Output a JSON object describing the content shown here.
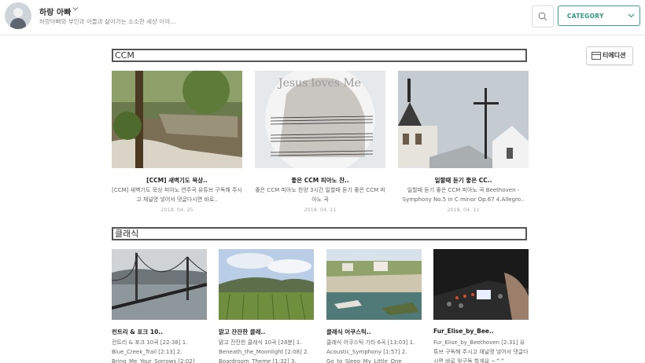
{
  "header": {
    "blog_title": "하랑 아빠",
    "blog_desc": "하랑아빠와 부인과 아들과 살아가는 소소한 세상 이야...",
    "category_label": "CATEGORY",
    "tedition_label": "티에디션"
  },
  "sections": [
    {
      "title": "CCM",
      "posts": [
        {
          "title": "[CCM] 새벽기도 묵상..",
          "summary": "[CCM] 새벽기도 묵상 피아노 연주곡 유튜브 구독해 주시고 채널명 넣어서 댓글다시면 바로..",
          "date": "2018. 04. 25"
        },
        {
          "title": "좋은 CCM 피아노 찬..",
          "summary": "좋은 CCM 피아노 찬양 3시간 일할때 듣기 좋은 CCM 피아노 곡",
          "date": "2018. 04. 11"
        },
        {
          "title": "일할때 듣기 좋은 CC..",
          "summary": "일할때 듣기 좋은 CCM 피아노 곡 Beethoven - Symphony No.5 in C minor Op.67 4.Allegro..",
          "date": "2018. 04. 11"
        }
      ]
    },
    {
      "title": "클래식",
      "posts": [
        {
          "title": "컨트리 & 포크 10..",
          "summary": "컨트리 & 포크 10곡 [22:38] 1. Blue_Creek_Trail [2:13] 2. Bring_Me_Your_Sorrows [2:02]"
        },
        {
          "title": "맑고 잔잔한 클래..",
          "summary": "맑고 잔잔한 클래식 10곡 [28분] 1. Beneath_the_Moonlight [2:08] 2. Boardroom_Theme [1:32] 3."
        },
        {
          "title": "클래식 어쿠스틱..",
          "summary": "클래식 어쿠스틱 기타 6곡 [13:03] 1. Acoustic_Symphony [1:57] 2. Go_to_Sleep_My_Little_One"
        },
        {
          "title": "Fur_Elise_by_Bee..",
          "summary": "Fur_Elise_by_Beethoven [2:31] 유튜브 구독해 주시고 채널명 넣어서 댓글다시면 바로 맞구독 할게요 ~^^"
        }
      ]
    }
  ],
  "colors": {
    "accent": "#2a9b7c",
    "section_border": "#555555"
  }
}
